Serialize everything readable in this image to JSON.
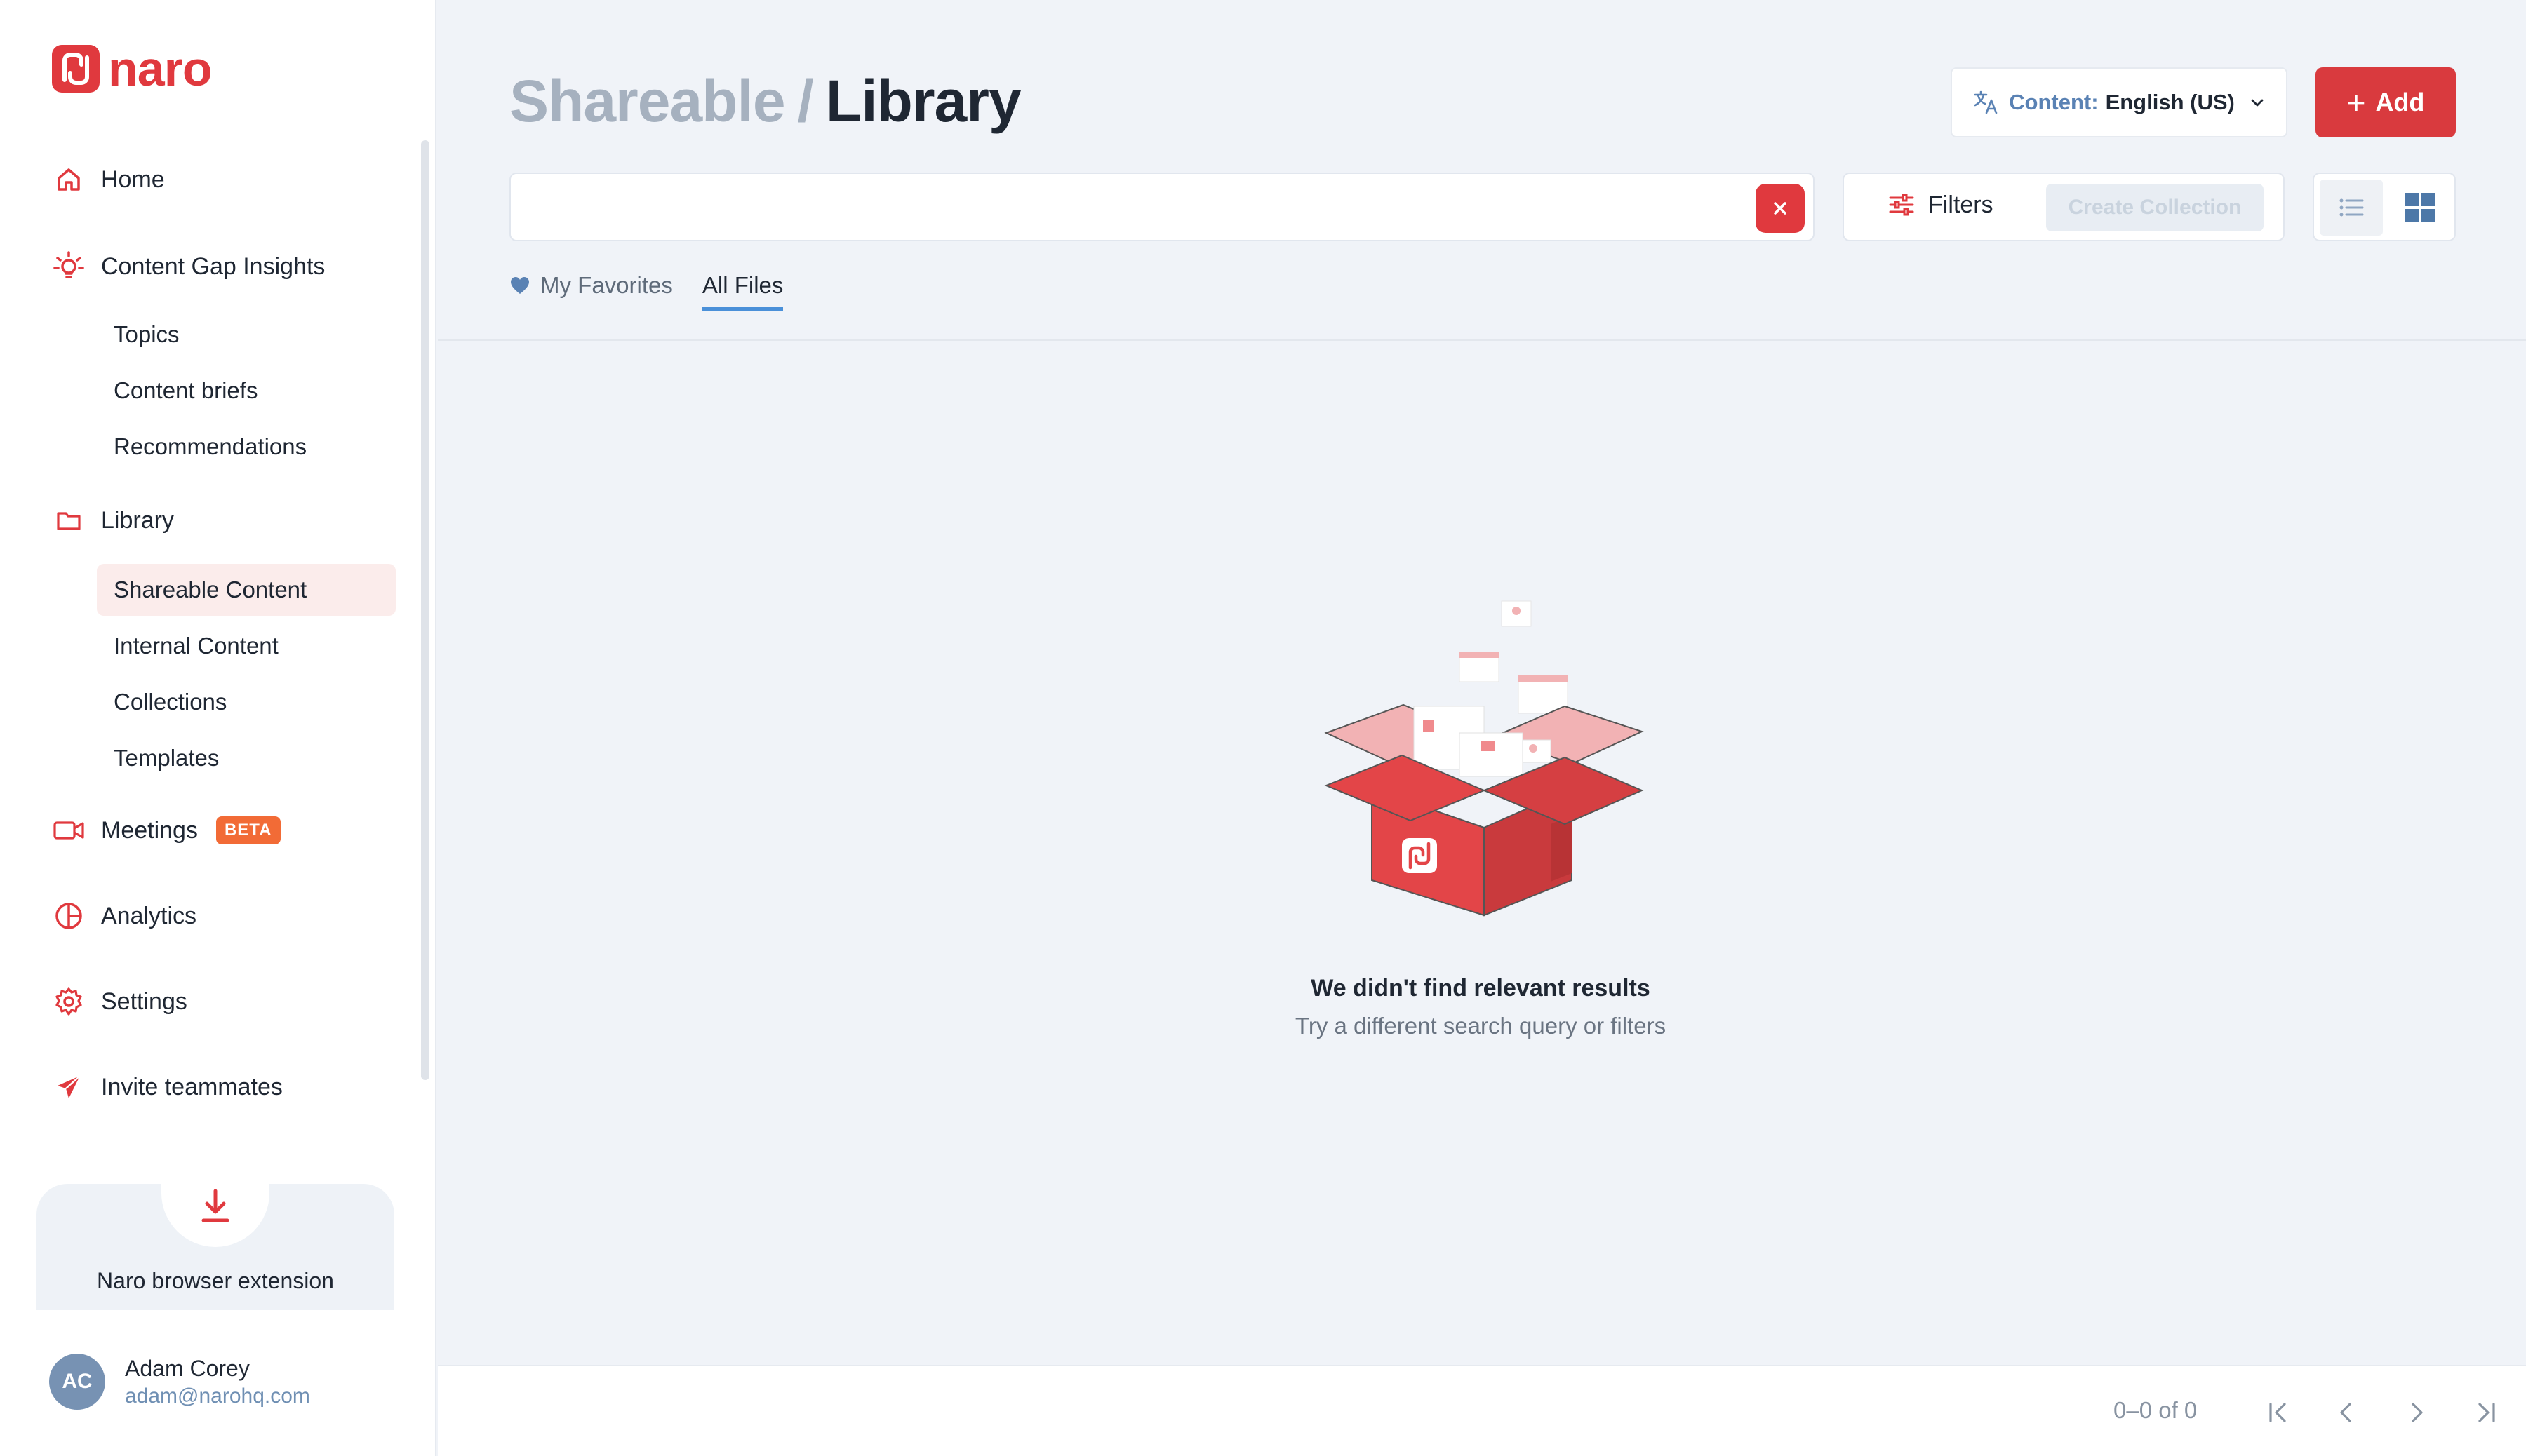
{
  "brand": {
    "name": "naro",
    "accent": "#e0393e"
  },
  "sidebar": {
    "nav": [
      {
        "label": "Home",
        "icon": "home-icon"
      },
      {
        "label": "Content Gap Insights",
        "icon": "lightbulb-icon"
      },
      {
        "label": "Library",
        "icon": "folder-icon"
      },
      {
        "label": "Meetings",
        "icon": "video-icon",
        "badge": "BETA"
      },
      {
        "label": "Analytics",
        "icon": "pie-chart-icon"
      },
      {
        "label": "Settings",
        "icon": "gear-icon"
      },
      {
        "label": "Invite teammates",
        "icon": "paper-plane-icon"
      }
    ],
    "insights_sub": [
      "Topics",
      "Content briefs",
      "Recommendations"
    ],
    "library_sub": [
      "Shareable Content",
      "Internal Content",
      "Collections",
      "Templates"
    ],
    "active_item": "Shareable Content",
    "extension_card": {
      "title": "Naro browser extension"
    },
    "user": {
      "initials": "AC",
      "name": "Adam Corey",
      "email": "adam@narohq.com"
    }
  },
  "header": {
    "breadcrumb_parent": "Shareable",
    "separator": "/",
    "title": "Library",
    "content_lang_label": "Content:",
    "content_lang_value": "English (US)",
    "add_label": "Add"
  },
  "search": {
    "value": "",
    "placeholder": ""
  },
  "toolbar": {
    "filters_label": "Filters",
    "create_collection_label": "Create Collection",
    "view_mode": "grid"
  },
  "tabs": [
    {
      "label": "My Favorites",
      "icon": "heart-icon",
      "active": false
    },
    {
      "label": "All Files",
      "active": true
    }
  ],
  "empty_state": {
    "title": "We didn't find relevant results",
    "subtitle": "Try a different search query or filters"
  },
  "pagination": {
    "range": "0–0 of 0"
  }
}
